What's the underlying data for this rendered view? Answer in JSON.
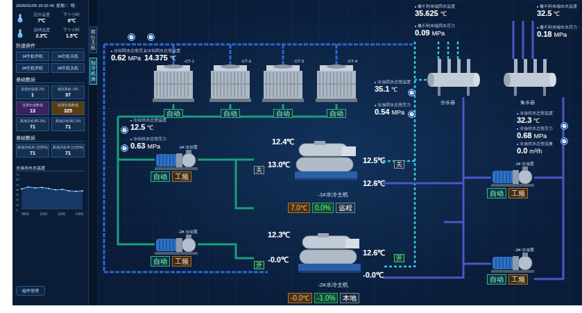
{
  "header": {
    "datetime": "2026/01/06 15:32:40",
    "weekday": "星期二",
    "weather": "晴"
  },
  "weather": [
    {
      "label": "室外温度",
      "value": "7℃"
    },
    {
      "label": "下个小时",
      "value": "6℃"
    },
    {
      "label": "湿球温度",
      "value": "2.3℃"
    },
    {
      "label": "下个小时",
      "value": "1.5℃"
    }
  ],
  "quick_ops": {
    "title": "快捷操作",
    "buttons": [
      "1#主机开机",
      "1#主机关机",
      "2#主机开机",
      "2#主机关机"
    ]
  },
  "basic_data": [
    {
      "title": "基础数据",
      "cells": [
        {
          "label": "温度比较值 (%)",
          "value": "1",
          "color": "#15304f"
        },
        {
          "label": "低压风机 (%)",
          "value": "37",
          "color": "#15304f"
        },
        {
          "label": "温度比值数值",
          "value": "13",
          "color": "#3d2260"
        },
        {
          "label": "温度比值数值",
          "value": "325",
          "color": "#5a3d12"
        },
        {
          "label": "风扇开机率1 (%)",
          "value": "71",
          "color": "#15304f"
        },
        {
          "label": "风扇开机率2 (%)",
          "value": "71",
          "color": "#15304f"
        }
      ]
    },
    {
      "title": "基础数据",
      "cells": [
        {
          "label": "风扇开机率 (首部%)",
          "value": "71",
          "color": "#15304f"
        },
        {
          "label": "风扇开机率 (次部%)",
          "value": "71",
          "color": "#15304f"
        }
      ]
    }
  ],
  "chart": {
    "title": "冷冻水出水温度",
    "y_ticks": [
      "70",
      "60",
      "50",
      "40",
      "30",
      "20",
      "10",
      "0"
    ],
    "x_ticks": [
      "0800",
      "1000",
      "1200",
      "1400"
    ],
    "series": [
      42,
      46,
      44,
      45,
      43,
      40,
      41,
      38,
      37,
      38
    ]
  },
  "footer_button": "组件管理",
  "side_tabs": [
    {
      "label": "前往主机",
      "selected": false
    },
    {
      "label": "制冷机房",
      "selected": true
    }
  ],
  "sensors": [
    {
      "label": "冷却回水总管压力",
      "value": "0.62",
      "unit": "MPa"
    },
    {
      "label": "冷却回水总管温度",
      "value": "14.375",
      "unit": "℃"
    },
    {
      "label": "冷却供水总管温度",
      "value": "12.5",
      "unit": "℃"
    },
    {
      "label": "冷却供水总管压力",
      "value": "0.63",
      "unit": "MPa"
    },
    {
      "label": "冷冻回水总管温度",
      "value": "35.1",
      "unit": "℃"
    },
    {
      "label": "冷冻回水总管压力",
      "value": "0.54",
      "unit": "MPa"
    },
    {
      "label": "最不利末端回水温度",
      "value": "35.625",
      "unit": "℃"
    },
    {
      "label": "最不利末端回水压力",
      "value": "0.09",
      "unit": "MPa"
    },
    {
      "label": "最不利末端出水温度",
      "value": "32.5",
      "unit": "℃"
    },
    {
      "label": "最不利末端出水压力",
      "value": "0.18",
      "unit": "MPa"
    },
    {
      "label": "冷冻供水总管温度",
      "value": "32.3",
      "unit": "℃"
    },
    {
      "label": "冷冻供水总管压力",
      "value": "0.68",
      "unit": "MPa"
    },
    {
      "label": "冷冻供水总管流量",
      "value": "0.0",
      "unit": "m³/h"
    }
  ],
  "towers": [
    {
      "name": "-CT-1",
      "mode": "自动"
    },
    {
      "name": "-CT-2",
      "mode": "自动"
    },
    {
      "name": "-CT-3",
      "mode": "自动"
    },
    {
      "name": "-CT-4",
      "mode": "自动"
    }
  ],
  "pumps": [
    {
      "name": "-1# 冷却泵",
      "mode": "自动",
      "freq": "工频"
    },
    {
      "name": "-2# 冷却泵",
      "mode": "自动",
      "freq": "工频"
    },
    {
      "name": "-1# 冷冻泵",
      "mode": "自动",
      "freq": "工频"
    },
    {
      "name": "-2# 冷冻泵",
      "mode": "自动",
      "freq": "工频"
    }
  ],
  "chillers": [
    {
      "name": "-1#水冷主机",
      "inlet_temp": "12.4℃",
      "cond_valve": {
        "label": "关",
        "open": false
      },
      "cond_temp": "13.0℃",
      "evap_valve": {
        "label": "关",
        "open": false
      },
      "evap_in_temp": "12.5℃",
      "evap_out_temp": "12.6℃",
      "setpoint": "7.0℃",
      "load": "0.0%",
      "mode": "远程"
    },
    {
      "name": "-2#水冷主机",
      "inlet_temp": "12.3℃",
      "cond_valve": {
        "label": "开",
        "open": true
      },
      "cond_temp": "-0.0℃",
      "evap_valve": {
        "label": "开",
        "open": true
      },
      "evap_in_temp": "12.6℃",
      "evap_out_temp": "-0.0℃",
      "setpoint": "-0.0℃",
      "load": "-1.0%",
      "mode": "本地"
    }
  ],
  "headers": [
    "分水器",
    "集水器"
  ]
}
